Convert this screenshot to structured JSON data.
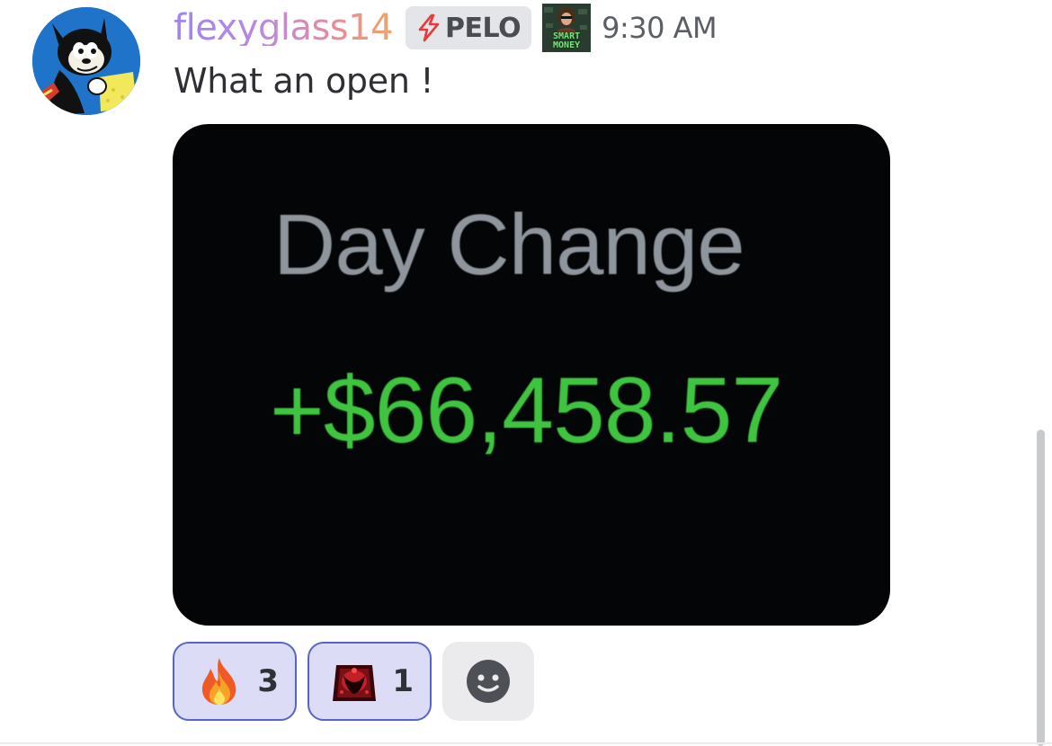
{
  "message": {
    "username": "flexyglass14",
    "tag": {
      "label": "PELO",
      "icon": "lightning-bolt-icon"
    },
    "badge": {
      "text_line1": "SMART",
      "text_line2": "MONEY"
    },
    "timestamp": "9:30 AM",
    "text": "What an open !"
  },
  "attachment": {
    "title": "Day Change",
    "value": "+$66,458.57",
    "value_color": "#3ec43e",
    "title_color": "#8e959d"
  },
  "reactions": [
    {
      "emoji": "fire-emoji-icon",
      "count": "3",
      "active": true
    },
    {
      "emoji": "red-crystal-emoji-icon",
      "count": "1",
      "active": true
    }
  ],
  "add_reaction": {
    "icon": "smiley-face-icon"
  },
  "colors": {
    "accent": "#5865c8",
    "reaction_bg": "#dcdcf7",
    "text": "#2e3035",
    "muted": "#5c5e66"
  }
}
